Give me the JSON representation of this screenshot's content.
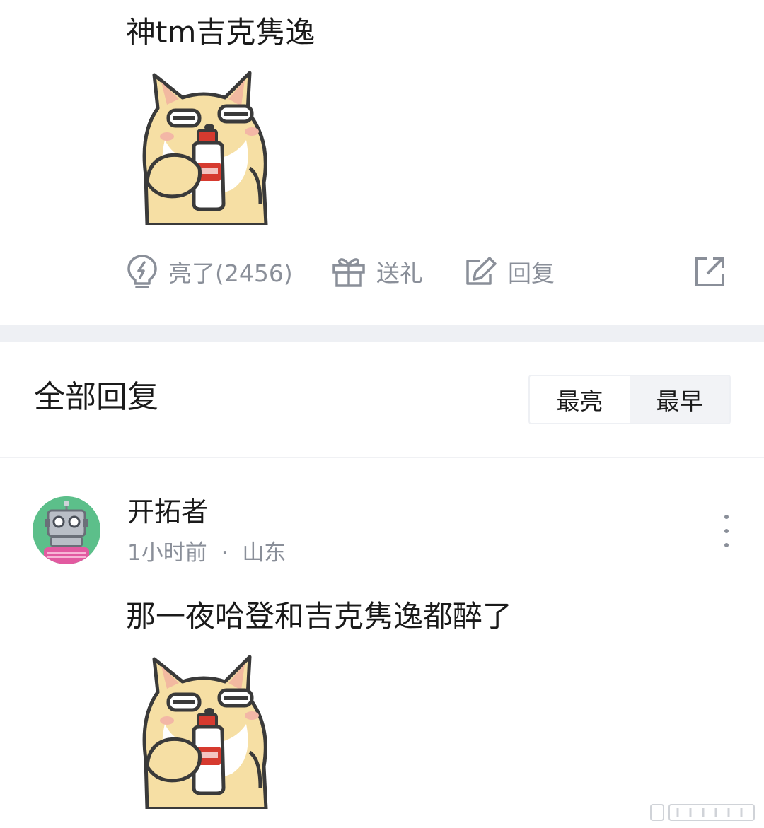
{
  "post": {
    "text": "神tm吉克隽逸",
    "sticker_icon": "shiba-dog-drinking-sticker"
  },
  "actions": {
    "like_label": "亮了(2456)",
    "gift_label": "送礼",
    "reply_label": "回复",
    "like_icon": "lightbulb-icon",
    "gift_icon": "gift-icon",
    "reply_icon": "edit-icon",
    "share_icon": "share-icon"
  },
  "replies": {
    "title": "全部回复",
    "sort_options": [
      "最亮",
      "最早"
    ],
    "active_sort": "最亮"
  },
  "reply": {
    "user_name": "开拓者",
    "time": "1小时前",
    "separator": "·",
    "location": "山东",
    "text": "那一夜哈登和吉克隽逸都醉了",
    "avatar_icon": "robot-avatar",
    "more_icon": "more-vertical-icon"
  },
  "colors": {
    "muted_text": "#8a8f99",
    "divider_band": "#eef0f4",
    "avatar_bg": "#5cbf8a"
  }
}
